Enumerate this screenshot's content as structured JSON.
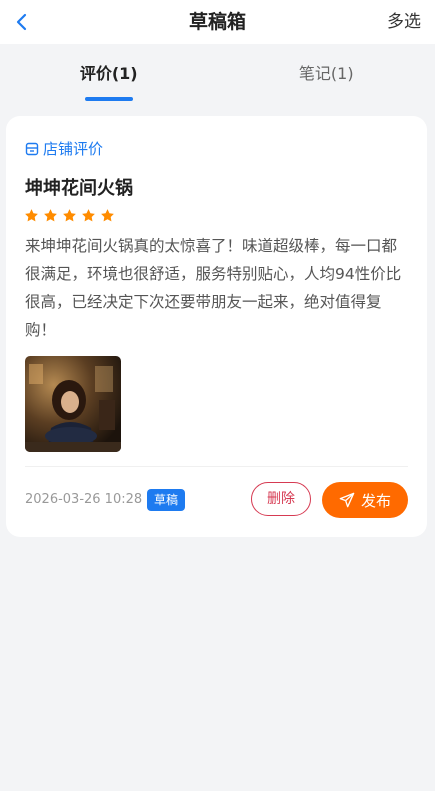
{
  "header": {
    "title": "草稿箱",
    "multi_select_label": "多选"
  },
  "tabs": [
    {
      "label": "评价(1)",
      "active": true
    },
    {
      "label": "笔记(1)",
      "active": false
    }
  ],
  "draft": {
    "category_label": "店铺评价",
    "shop_name": "坤坤花间火锅",
    "rating": 5,
    "review_text": "来坤坤花间火锅真的太惊喜了！味道超级棒，每一口都很满足，环境也很舒适，服务特别贴心，人均94性价比很高，已经决定下次还要带朋友一起来，绝对值得复购！",
    "timestamp": "2026-03-26 10:28",
    "status_badge": "草稿",
    "delete_label": "删除",
    "publish_label": "发布"
  },
  "colors": {
    "accent": "#1e7bf0",
    "star": "#ff8c00",
    "delete": "#d63a52",
    "publish": "#ff6a00"
  }
}
